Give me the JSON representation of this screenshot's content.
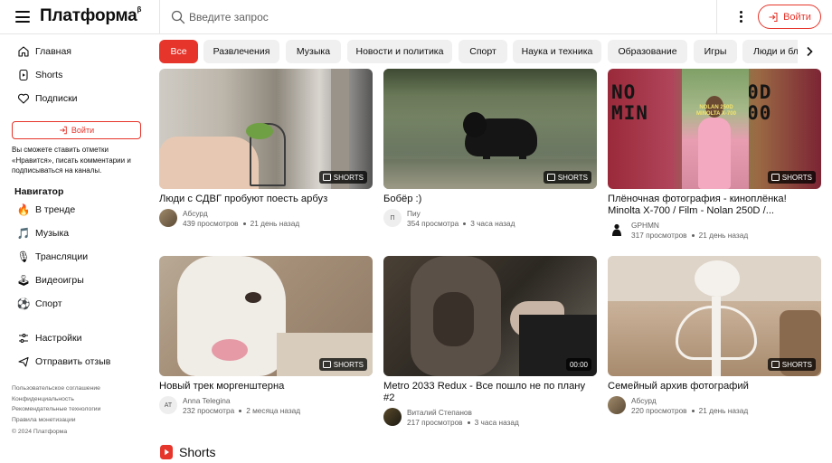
{
  "header": {
    "logo": "Платформа",
    "logo_sup": "β",
    "search_placeholder": "Введите запрос",
    "login_label": "Войти"
  },
  "sidebar": {
    "main_items": [
      {
        "label": "Главная",
        "icon": "home-icon"
      },
      {
        "label": "Shorts",
        "icon": "shorts-icon"
      },
      {
        "label": "Подписки",
        "icon": "heart-icon"
      }
    ],
    "login_label": "Войти",
    "hint": "Вы сможете ставить отметки «Нравится», писать комментарии и подписываться на каналы.",
    "navigator_heading": "Навигатор",
    "navigator_items": [
      {
        "label": "В тренде",
        "icon": "fire-icon"
      },
      {
        "label": "Музыка",
        "icon": "music-note-icon"
      },
      {
        "label": "Трансляции",
        "icon": "broadcast-icon"
      },
      {
        "label": "Видеоигры",
        "icon": "gamepad-icon"
      },
      {
        "label": "Спорт",
        "icon": "ball-icon"
      }
    ],
    "bottom_items": [
      {
        "label": "Настройки",
        "icon": "settings-icon"
      },
      {
        "label": "Отправить отзыв",
        "icon": "feedback-icon"
      }
    ],
    "footer_links": [
      "Пользовательское соглашение",
      "Конфиденциальность",
      "Рекомендательные технологии",
      "Правила монетизации"
    ],
    "copyright": "© 2024 Платформа"
  },
  "chips": [
    "Все",
    "Развлечения",
    "Музыка",
    "Новости и политика",
    "Спорт",
    "Наука и техника",
    "Образование",
    "Игры",
    "Люди и блоги"
  ],
  "active_chip": "Все",
  "videos": [
    {
      "title": "Люди с СДВГ пробуют поесть арбуз",
      "channel": "Абсурд",
      "views": "439 просмотров",
      "age": "21 день назад",
      "badge": "SHORTS",
      "avatar_text": ""
    },
    {
      "title": "Бобёр :)",
      "channel": "Пиу",
      "views": "354 просмотра",
      "age": "3 часа назад",
      "badge": "SHORTS",
      "avatar_text": "П"
    },
    {
      "title": "Плёночная фотография - киноплёнка! Minolta X-700 / Film - Nolan 250D /...",
      "channel": "GPHMN",
      "views": "317 просмотров",
      "age": "21 день назад",
      "badge": "SHORTS",
      "avatar_text": "",
      "thumb_text_top": "NO        00D",
      "thumb_text_bottom": "MIN       700",
      "thumb_caption": "NOLAN 250D MINOLTA X-700"
    },
    {
      "title": "Новый трек моргенштерна",
      "channel": "Anna Telegina",
      "views": "232 просмотра",
      "age": "2 месяца назад",
      "badge": "SHORTS",
      "avatar_text": "AT"
    },
    {
      "title": "Metro 2033 Redux - Все пошло не по плану #2",
      "channel": "Виталий Степанов",
      "views": "217 просмотров",
      "age": "3 часа назад",
      "badge": "00:00",
      "avatar_text": ""
    },
    {
      "title": "Семейный архив фотографий",
      "channel": "Абсурд",
      "views": "220 просмотров",
      "age": "21 день назад",
      "badge": "SHORTS",
      "avatar_text": ""
    }
  ],
  "shorts_section_title": "Shorts",
  "colors": {
    "accent": "#e6352b",
    "chip_bg": "#f0f0f0",
    "secondary_text": "#606060"
  }
}
